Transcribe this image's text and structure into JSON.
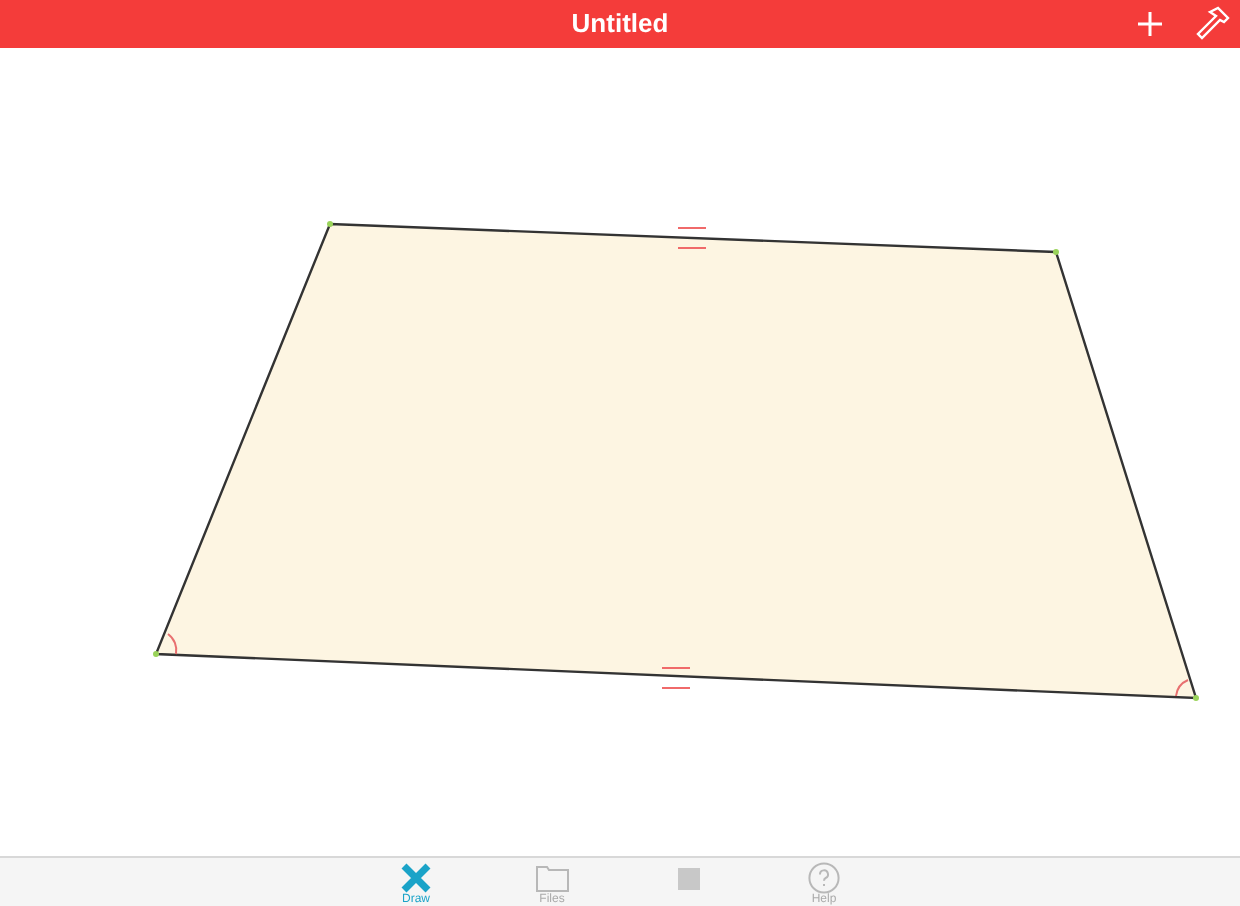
{
  "header": {
    "title": "Untitled"
  },
  "tabs": [
    {
      "kind": "draw",
      "label": "Draw",
      "selected": true
    },
    {
      "kind": "folder",
      "label": "Files",
      "selected": false
    },
    {
      "kind": "square",
      "selected": false
    },
    {
      "kind": "help",
      "label": "Help",
      "selected": false
    }
  ]
}
